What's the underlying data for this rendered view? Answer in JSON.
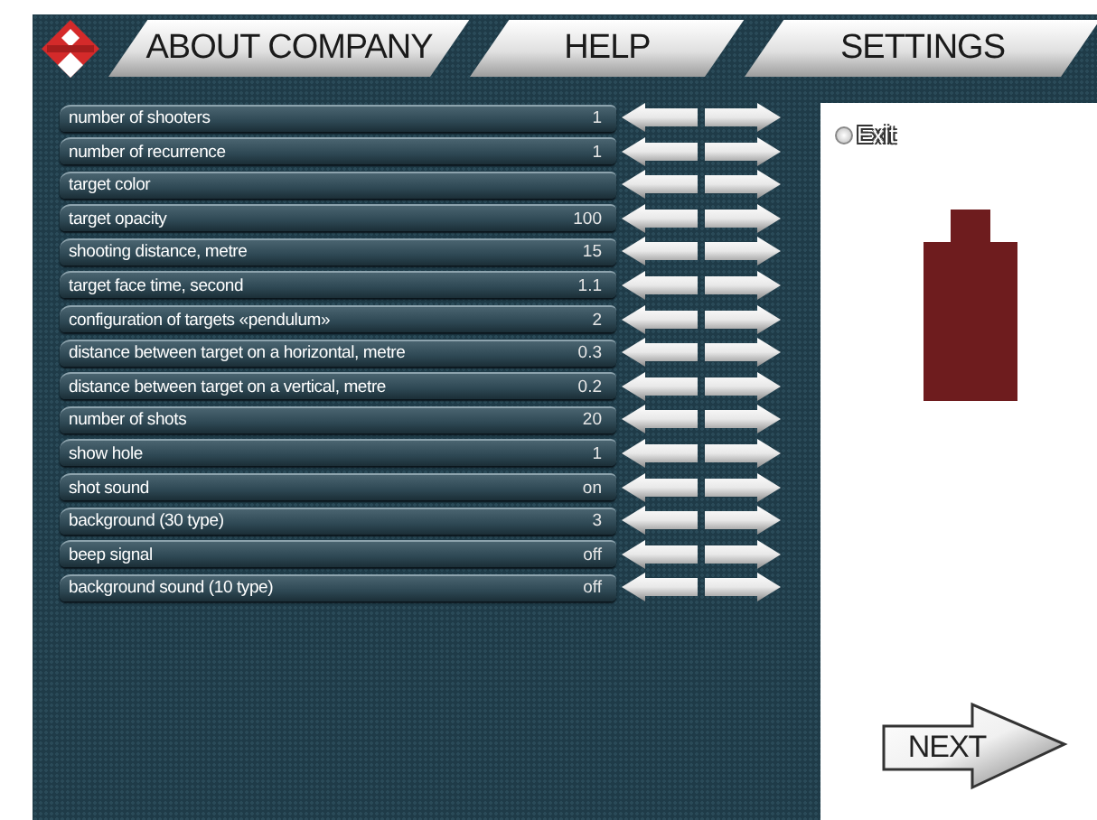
{
  "tabs": [
    {
      "label": "ABOUT COMPANY"
    },
    {
      "label": "HELP"
    },
    {
      "label": "SETTINGS"
    }
  ],
  "settings": [
    {
      "label": "number of shooters",
      "value": "1"
    },
    {
      "label": "number of recurrence",
      "value": "1"
    },
    {
      "label": "target color"
    },
    {
      "label": "target opacity",
      "value": "100"
    },
    {
      "label": "shooting distance, metre",
      "value": "15"
    },
    {
      "label": "target  face time, second",
      "value": "1.1"
    },
    {
      "label": "configuration of targets «pendulum»",
      "value": "2"
    },
    {
      "label": "distance between target on a horizontal, metre",
      "value": "0.3"
    },
    {
      "label": "distance between target on a vertical, metre",
      "value": "0.2"
    },
    {
      "label": "number of shots",
      "value": "20"
    },
    {
      "label": "show hole",
      "value": "1"
    },
    {
      "label": "shot sound",
      "value": "on"
    },
    {
      "label": "background (30 type)",
      "value": "3"
    },
    {
      "label": "beep signal",
      "value": "off"
    },
    {
      "label": "background sound (10 type)",
      "value": "off"
    }
  ],
  "exit": {
    "label": "Exit",
    "checked": false
  },
  "next_button": {
    "label": "NEXT"
  }
}
